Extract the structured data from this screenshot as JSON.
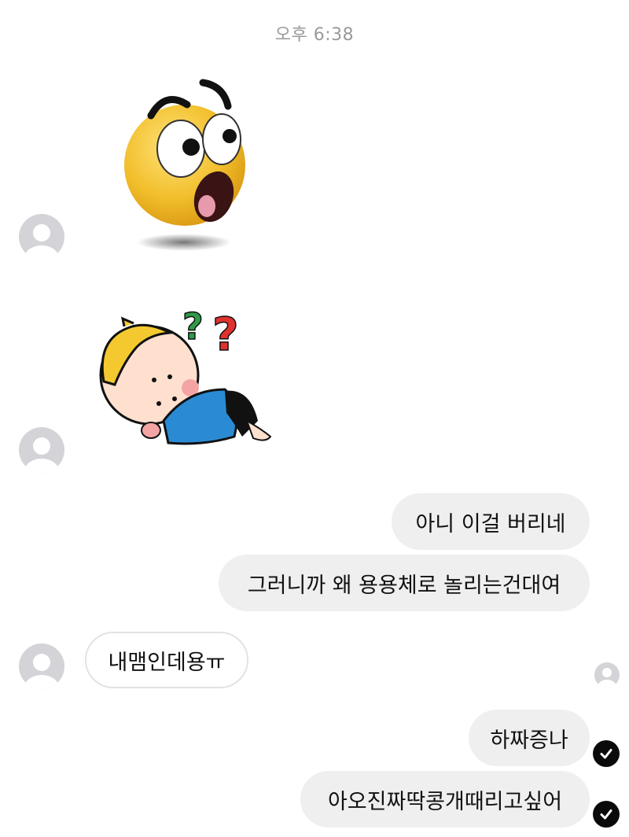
{
  "chat": {
    "timestamp": "오후 6:38",
    "messages": [
      {
        "sender": "other",
        "type": "sticker",
        "sticker": "shocked-emoji-sticker"
      },
      {
        "sender": "other",
        "type": "sticker",
        "sticker": "confused-baby-sticker"
      },
      {
        "sender": "me",
        "type": "text",
        "text": "아니 이걸 버리네"
      },
      {
        "sender": "me",
        "type": "text",
        "text": "그러니까 왜 용용체로 놀리는건대여"
      },
      {
        "sender": "other",
        "type": "text",
        "text": "내맴인데용ㅠ"
      },
      {
        "sender": "me",
        "type": "text",
        "text": "하짜증나",
        "status": "read-check-icon"
      },
      {
        "sender": "me",
        "type": "text",
        "text": "아오진짜딱콩개때리고싶어",
        "status": "read-check-icon"
      }
    ]
  },
  "colors": {
    "sent_bubble": "#efefef",
    "received_bubble_border": "#e3e3e3",
    "avatar_placeholder": "#d4d4d8",
    "timestamp_text": "#9a9a9a",
    "read_check": "#0a0a0a"
  }
}
